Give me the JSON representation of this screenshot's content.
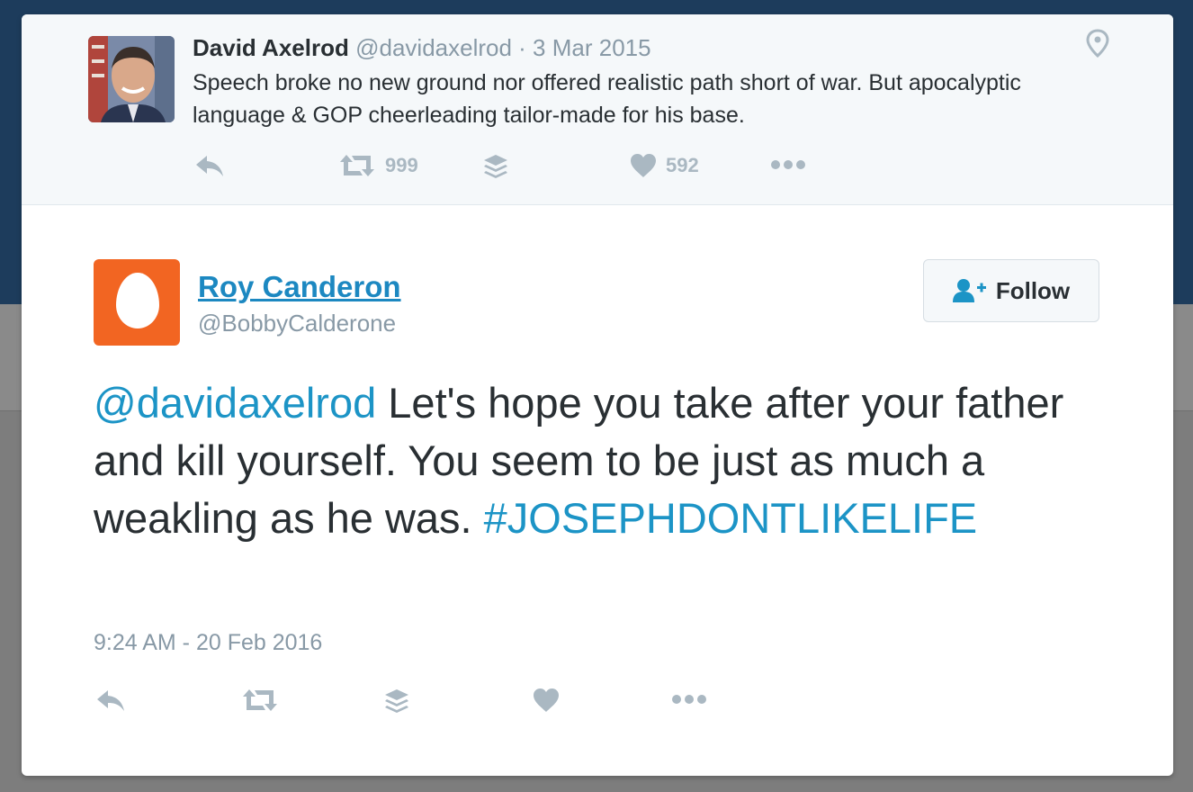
{
  "parent_tweet": {
    "name": "David Axelrod",
    "handle": "@davidaxelrod",
    "separator": " · ",
    "date": "3 Mar 2015",
    "text": "Speech broke no new ground nor offered realistic path short of war.  But apocalyptic language & GOP cheerleading tailor-made for his base.",
    "retweet_count": "999",
    "like_count": "592",
    "icons": [
      "reply-icon",
      "retweet-icon",
      "buffer-icon",
      "heart-icon",
      "more-icon",
      "location-pin-icon"
    ]
  },
  "tweet": {
    "name": "Roy Canderon",
    "handle": "@BobbyCalderone",
    "follow_label": "Follow",
    "mention": "@davidaxelrod",
    "body": " Let's hope you take after your father and kill yourself. You seem to be just as much a weakling as he was. ",
    "hashtag": "#JOSEPHDONTLIKELIFE",
    "timestamp": "9:24 AM - 20 Feb 2016",
    "icons": [
      "reply-icon",
      "retweet-icon",
      "buffer-icon",
      "heart-icon",
      "more-icon"
    ]
  },
  "colors": {
    "link": "#1c94c6",
    "name_link": "#1c88c1",
    "icon_gray": "#aab8c2",
    "avatar_egg_bg": "#f26522",
    "page_top_bg": "#1d3c5c"
  }
}
